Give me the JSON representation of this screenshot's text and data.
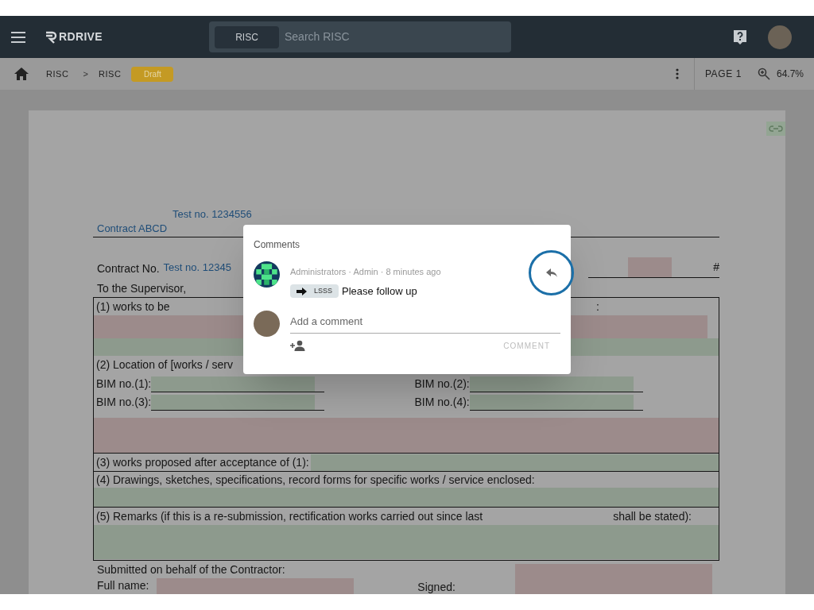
{
  "header": {
    "logo": "RDRIVE",
    "search": {
      "scope": "RISC",
      "placeholder": "Search RISC"
    }
  },
  "breadcrumb": {
    "items": [
      "RISC",
      "RISC"
    ],
    "separator": ">",
    "status": "Draft",
    "page": "PAGE 1",
    "zoom": "64.7%"
  },
  "document": {
    "test_no_top": "Test no. 1234556",
    "contract_name": "Contract ABCD",
    "contract_label": "Contract No.",
    "contract_value": "Test no. 12345",
    "hash": "#",
    "to_line": "To the Supervisor,",
    "row_1": {
      "label": "(1) works to be",
      "colon": ":"
    },
    "row_2": {
      "label": "(2) Location of [works / serv",
      "bim": [
        "BIM no.(1):",
        "BIM no.(2):",
        "BIM no.(3):",
        "BIM no.(4):"
      ]
    },
    "row_3": "(3) works proposed after acceptance of (1):",
    "row_4": "(4) Drawings, sketches, specifications, record forms for specific works / service enclosed:",
    "row_5": {
      "label": "(5) Remarks (if this is a re-submission, rectification works carried out since last",
      "tail": "shall be stated):"
    },
    "submitted": "Submitted on behalf of the Contractor:",
    "full_name": "Full name:",
    "signed": "Signed:"
  },
  "dialog": {
    "title": "Comments",
    "comments": [
      {
        "meta": "Administrators · Admin · 8 minutes ago",
        "tag": "LSSS",
        "text": "Please follow up",
        "highlighted": true
      }
    ],
    "input": {
      "placeholder": "Add a comment"
    },
    "submit": {
      "label": "COMMENT",
      "disabled": true
    }
  }
}
